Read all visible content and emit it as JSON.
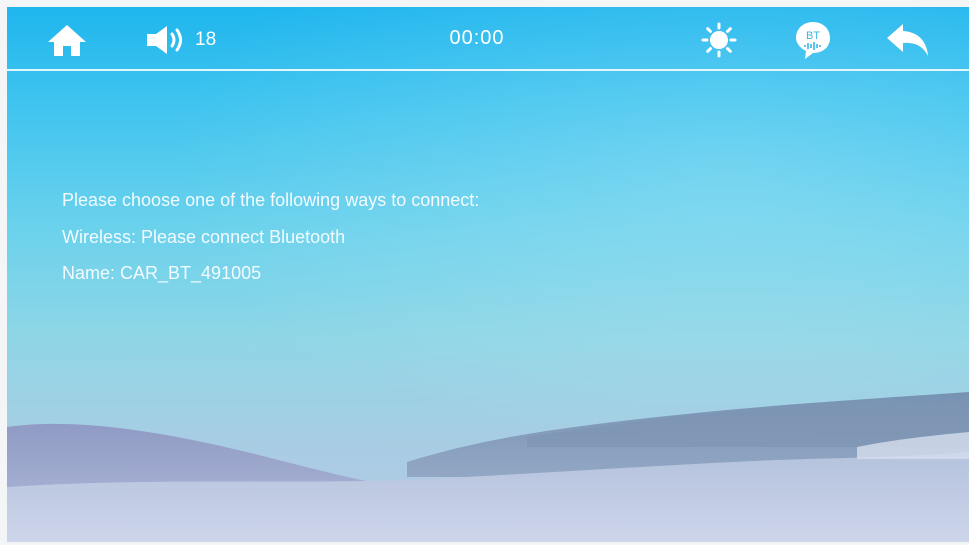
{
  "status_bar": {
    "volume_level": "18",
    "clock": "00:00",
    "bluetooth_badge": "BT",
    "icons": {
      "home": "home-icon",
      "volume": "volume-icon",
      "brightness": "sun-icon",
      "bluetooth": "bluetooth-icon",
      "back": "back-arrow-icon"
    }
  },
  "connect_prompt": {
    "line1": "Please choose one of the following ways to connect:",
    "line2": "Wireless: Please connect Bluetooth",
    "line3": "Name: CAR_BT_491005"
  },
  "colors": {
    "sky_top": "#1fb6ee",
    "sky_bottom": "#b7c9e5",
    "text": "#ffffff"
  }
}
